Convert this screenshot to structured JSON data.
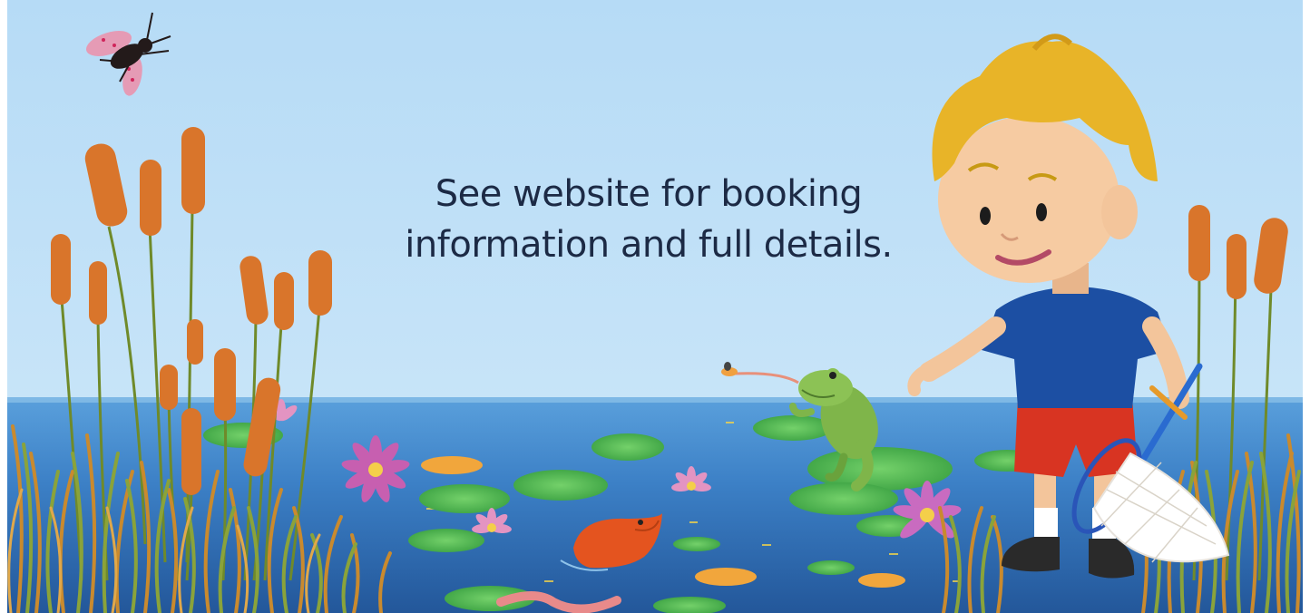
{
  "message": {
    "line1": "See website for booking",
    "line2": "information and full details."
  },
  "colors": {
    "sky": "#b9dcf5",
    "pond": "#3f86c9",
    "text": "#1c2a45",
    "reed": "#d9752b",
    "lily_pad": "#5cc25a",
    "shirt": "#1c4fa3",
    "shorts": "#d83422",
    "hair": "#e8b428",
    "frog": "#7fb54a",
    "fish": "#e4541f"
  },
  "illustration": {
    "subjects": [
      "fly-icon",
      "cattail-icon",
      "lily-pad-icon",
      "water-lily-icon",
      "frog-icon",
      "fish-icon",
      "worm-icon",
      "boy-icon",
      "net-icon",
      "grass-icon"
    ]
  }
}
